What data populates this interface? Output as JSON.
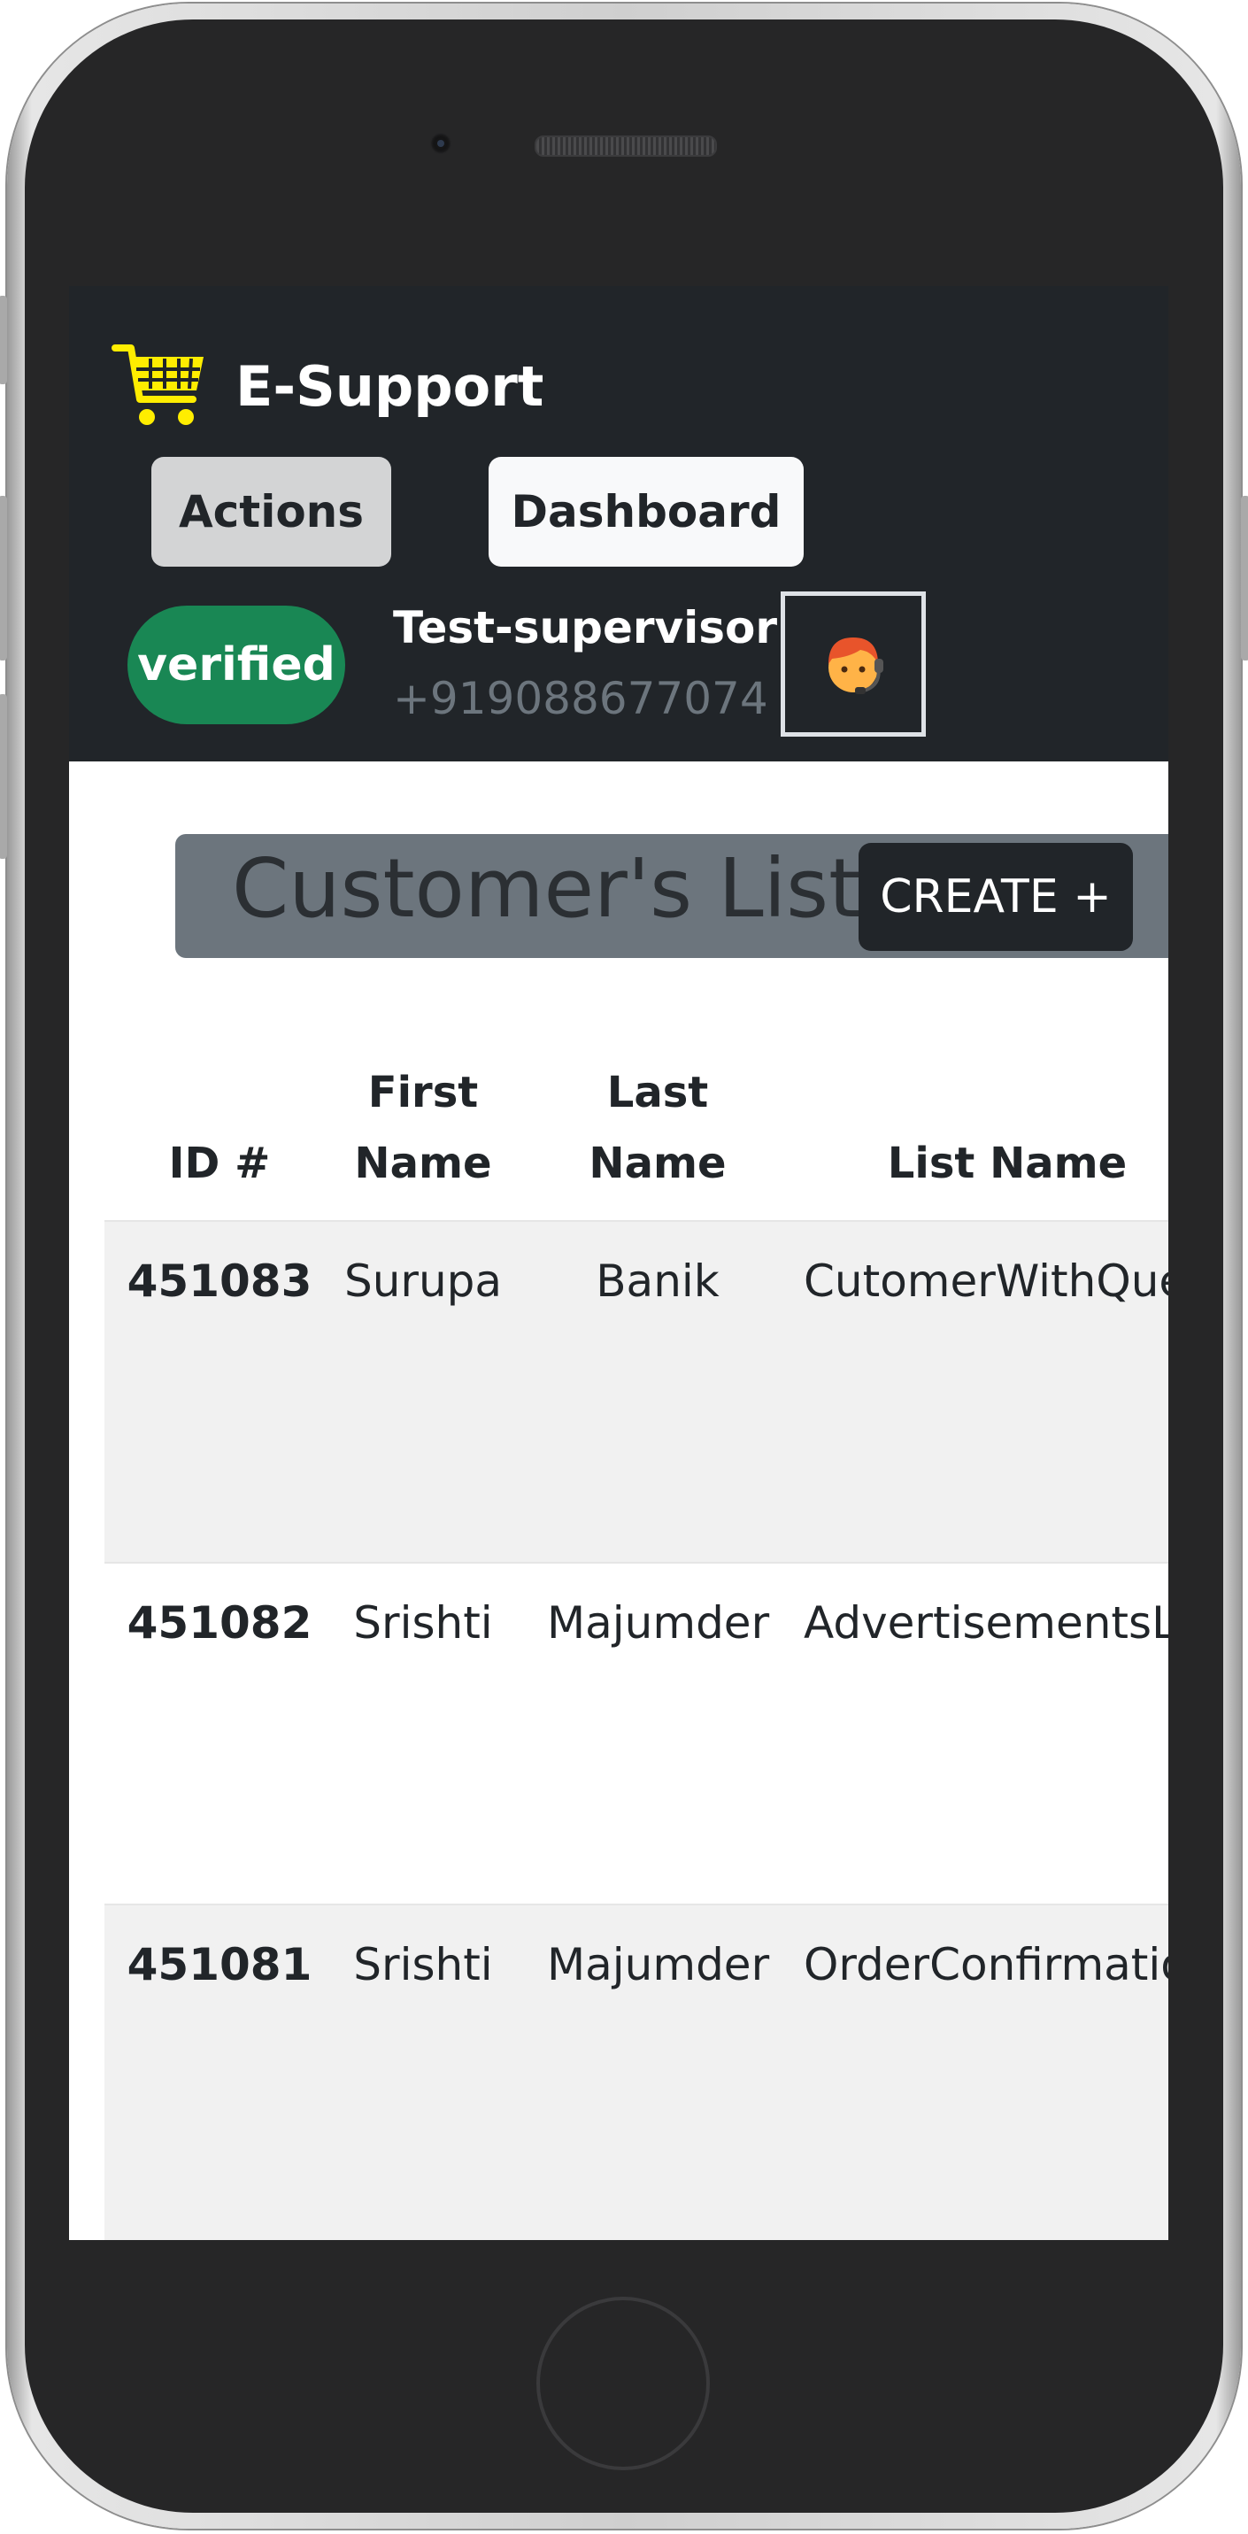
{
  "app": {
    "brand": "E-Support"
  },
  "nav": {
    "actions_label": "Actions",
    "dashboard_label": "Dashboard"
  },
  "user": {
    "status_badge": "verified",
    "name": "Test-supervisor",
    "phone": "+919088677074",
    "avatar_icon": "support-agent-icon"
  },
  "page": {
    "title": "Customer's List",
    "create_label": "CREATE +"
  },
  "table": {
    "headers": {
      "id": "ID #",
      "first_name_line1": "First",
      "first_name_line2": "Name",
      "last_name_line1": "Last",
      "last_name_line2": "Name",
      "list_name": "List Name"
    },
    "rows": [
      {
        "id": "451083",
        "first": "Surupa",
        "last": "Banik",
        "list": "CutomerWithQue"
      },
      {
        "id": "451082",
        "first": "Srishti",
        "last": "Majumder",
        "list": "AdvertisementsL"
      },
      {
        "id": "451081",
        "first": "Srishti",
        "last": "Majumder",
        "list": "OrderConfirmatio"
      }
    ]
  },
  "colors": {
    "navbar": "#212529",
    "cart_icon": "#ffed00",
    "verified_badge": "#198754",
    "title_bar": "#6c757d"
  }
}
